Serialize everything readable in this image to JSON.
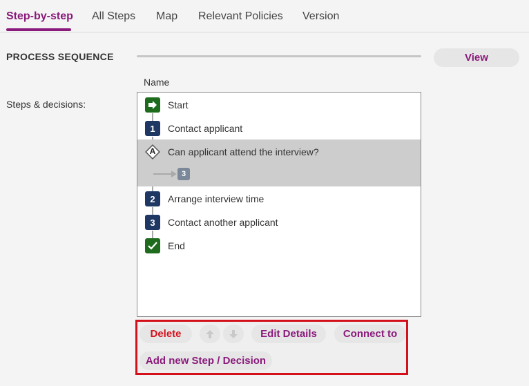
{
  "tabs": [
    {
      "label": "Step-by-step",
      "active": true
    },
    {
      "label": "All Steps",
      "active": false
    },
    {
      "label": "Map",
      "active": false
    },
    {
      "label": "Relevant Policies",
      "active": false
    },
    {
      "label": "Version",
      "active": false
    }
  ],
  "section": {
    "title": "PROCESS SEQUENCE",
    "view_label": "View"
  },
  "table": {
    "column_header": "Name",
    "field_label": "Steps & decisions:"
  },
  "steps": [
    {
      "badge": "",
      "type": "start",
      "label": "Start"
    },
    {
      "badge": "1",
      "type": "step",
      "label": "Contact applicant"
    },
    {
      "badge": "A",
      "type": "decision",
      "label": "Can applicant attend the interview?",
      "selected": true,
      "branch_to": "3"
    },
    {
      "badge": "2",
      "type": "step",
      "label": "Arrange interview time"
    },
    {
      "badge": "3",
      "type": "step",
      "label": "Contact another applicant"
    },
    {
      "badge": "",
      "type": "end",
      "label": "End"
    }
  ],
  "toolbar": {
    "delete_label": "Delete",
    "edit_label": "Edit Details",
    "connect_label": "Connect to",
    "add_label": "Add new Step / Decision"
  },
  "colors": {
    "accent": "#8a1a7b",
    "delete": "#d4111b",
    "step_badge": "#1f3763",
    "start_end_badge": "#1e6b1e",
    "highlight_frame": "#d4111b"
  }
}
